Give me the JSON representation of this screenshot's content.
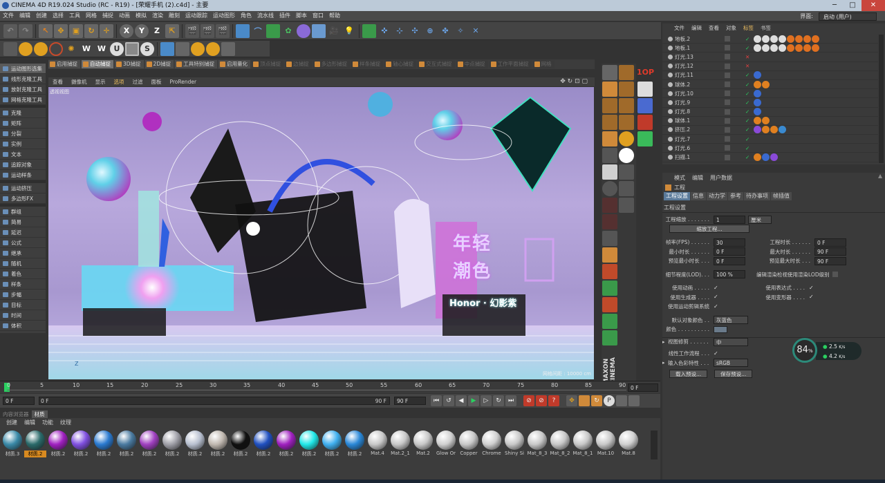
{
  "window": {
    "title": "CINEMA 4D R19.024 Studio (RC - R19) - [荣耀手机 (2).c4d] - 主要",
    "minimize": "─",
    "maximize": "□",
    "close": "✕"
  },
  "menu": {
    "items": [
      "文件",
      "编辑",
      "创建",
      "选择",
      "工具",
      "网格",
      "捕捉",
      "动画",
      "模拟",
      "渲染",
      "雕刻",
      "运动跟踪",
      "运动图形",
      "角色",
      "流水线",
      "插件",
      "脚本",
      "窗口",
      "帮助"
    ],
    "layout_label": "界面:",
    "layout_value": "启动 (用户)"
  },
  "toolbar1": {
    "xyz": [
      "X",
      "Y",
      "Z"
    ]
  },
  "left_panel": {
    "group1": [
      "运动图形选集",
      "线形克隆工具",
      "放射克隆工具",
      "网格克隆工具"
    ],
    "group2": [
      "克隆",
      "矩阵",
      "分裂",
      "实例",
      "文本",
      "追踪对象",
      "运动样条"
    ],
    "group3": [
      "运动挤压",
      "多边形FX"
    ],
    "group4": [
      "群组",
      "简易",
      "延迟",
      "公式",
      "继承",
      "随机",
      "着色",
      "样条",
      "步幅",
      "目标",
      "时间",
      "体积"
    ]
  },
  "mode_bar": {
    "items": [
      "启用捕捉",
      "自动捕捉",
      "3D捕捉",
      "2D捕捉",
      "工具特别捕捉",
      "启用量化",
      "顶点捕捉",
      "边捕捉",
      "多边形捕捉",
      "样条捕捉",
      "轴心捕捉",
      "交互式捕捉",
      "中点捕捉",
      "工作平面捕捉",
      "网格"
    ]
  },
  "viewport": {
    "menu": [
      "查看",
      "摄像机",
      "显示",
      "选项",
      "过滤",
      "面板",
      "ProRender"
    ],
    "label": "透视视图",
    "grid_info": "网格间距 : 10000 cm",
    "axis_z": "Z"
  },
  "scene_text": {
    "line1": "年轻",
    "line2": "潮色",
    "brand": "Honor · 幻影紫",
    "watermark": "MAXON CINEMA"
  },
  "vtools_text": {
    "t1": "1OP"
  },
  "timeline": {
    "ticks": [
      "0",
      "5",
      "10",
      "15",
      "20",
      "25",
      "30",
      "35",
      "40",
      "45",
      "50",
      "55",
      "60",
      "65",
      "70",
      "75",
      "80",
      "85",
      "90"
    ],
    "end_field": "0 F"
  },
  "transport": {
    "start": "0 F",
    "range_end": "90 F",
    "end": "90 F"
  },
  "materials": {
    "tabs": [
      "内容浏览器",
      "材质"
    ],
    "menu": [
      "创建",
      "编辑",
      "功能",
      "纹理"
    ],
    "items": [
      {
        "name": "材质.3",
        "color": "#3a8aa8"
      },
      {
        "name": "材质.2",
        "color": "#2a6a6a",
        "active": true
      },
      {
        "name": "材质.2",
        "color": "#a020c0"
      },
      {
        "name": "材质.2",
        "color": "#8050e0"
      },
      {
        "name": "材质.2",
        "color": "#2a7ad0"
      },
      {
        "name": "材质.2",
        "color": "#4a7aa0"
      },
      {
        "name": "材质.2",
        "color": "#a040c0"
      },
      {
        "name": "材质.2",
        "color": "#a0a0a8"
      },
      {
        "name": "材质.2",
        "color": "#b8c0d0"
      },
      {
        "name": "材质.2",
        "color": "#c0b8b0"
      },
      {
        "name": "材质.2",
        "color": "#101010"
      },
      {
        "name": "材质.2",
        "color": "#2050c0"
      },
      {
        "name": "材质.2",
        "color": "#a020c0"
      },
      {
        "name": "材质.2",
        "color": "#20e8e8"
      },
      {
        "name": "材质.2",
        "color": "#40b0f0"
      },
      {
        "name": "材质.2",
        "color": "#2a88d8"
      },
      {
        "name": "Mat.4",
        "color": "#c8c8c8"
      },
      {
        "name": "Mat.2_1",
        "color": "#c8c8c8"
      },
      {
        "name": "Mat.2",
        "color": "#c8c8c8"
      },
      {
        "name": "Glow Or",
        "color": "#d0d0d0"
      },
      {
        "name": "Copper",
        "color": "#c8c8c8"
      },
      {
        "name": "Chrome",
        "color": "#d0d0d0"
      },
      {
        "name": "Shiny Si",
        "color": "#c8c8c8"
      },
      {
        "name": "Mat_8_3",
        "color": "#c8c8c8"
      },
      {
        "name": "Mat_8_2",
        "color": "#c8c8c8"
      },
      {
        "name": "Mat_8_1",
        "color": "#c8c8c8"
      },
      {
        "name": "Mat.10",
        "color": "#c8c8c8"
      },
      {
        "name": "Mat.8",
        "color": "#d0d0d0"
      }
    ]
  },
  "object_manager": {
    "menu": [
      "文件",
      "编辑",
      "查看",
      "对象",
      "标签",
      "书签"
    ],
    "rows": [
      {
        "name": "地板.2",
        "check": "✓"
      },
      {
        "name": "地板.1",
        "check": "✓"
      },
      {
        "name": "灯光.13",
        "check": "✕"
      },
      {
        "name": "灯光.12",
        "check": "✕"
      },
      {
        "name": "灯光.11",
        "check": "✓"
      },
      {
        "name": "球体.2",
        "check": "✓"
      },
      {
        "name": "灯光.10",
        "check": "✓"
      },
      {
        "name": "灯光.9",
        "check": "✓"
      },
      {
        "name": "灯光.8",
        "check": "✓"
      },
      {
        "name": "球体.1",
        "check": "✓"
      },
      {
        "name": "挤压.2",
        "check": "✓"
      },
      {
        "name": "灯光.7",
        "check": "✓"
      },
      {
        "name": "灯光.6",
        "check": "✓"
      },
      {
        "name": "扫描.1",
        "check": "✓"
      }
    ]
  },
  "attributes": {
    "menu": [
      "模式",
      "编辑",
      "用户数据"
    ],
    "title": "工程",
    "tabs": [
      "工程设置",
      "信息",
      "动力学",
      "参考",
      "待办事项",
      "帧插值"
    ],
    "section": "工程设置",
    "scale_label": "工程缩放 . . . . . . .",
    "scale_value": "1",
    "scale_unit": "厘米",
    "scale_btn": "缩放工程...",
    "fps_label": "帧率(FPS) . . . . . .",
    "fps_value": "30",
    "duration_label": "工程时长 . . . . . .",
    "duration_value": "0 F",
    "mintime_label": "最小时长 . . . . . .",
    "mintime_value": "0 F",
    "maxtime_label": "最大时长 . . . . . .",
    "maxtime_value": "90 F",
    "prevmin_label": "预览最小时长 . . .",
    "prevmin_value": "0 F",
    "prevmax_label": "预览最大时长 . . .",
    "prevmax_value": "90 F",
    "lod_label": "细节程度(LOD). . .",
    "lod_value": "100 %",
    "lod_render": "编辑渲染检视使用渲染LOD级别",
    "anim": "使用动画 . . . . .",
    "expr": "使用表达式 . . . .",
    "gen": "使用生成器 . . . .",
    "deform": "使用变形器 . . . .",
    "motion": "使用运动剪辑系统",
    "defcolor_label": "默认对象颜色 . .",
    "defcolor_value": "灰蓝色",
    "color_label": "颜色 . . . . . . . . . .",
    "viewclip_label": "视图修剪 . . . . . .",
    "viewclip_value": "中",
    "linear": "线性工作流程 . . .",
    "inputcolor_label": "输入色彩特性 . . .",
    "inputcolor_value": "sRGB",
    "load_btn": "载入预设...",
    "save_btn": "保存预设..."
  },
  "perf": {
    "percent": "84",
    "percent_sign": "%",
    "up": "2.5",
    "up_unit": "K/s",
    "down": "4.2",
    "down_unit": "K/s"
  }
}
